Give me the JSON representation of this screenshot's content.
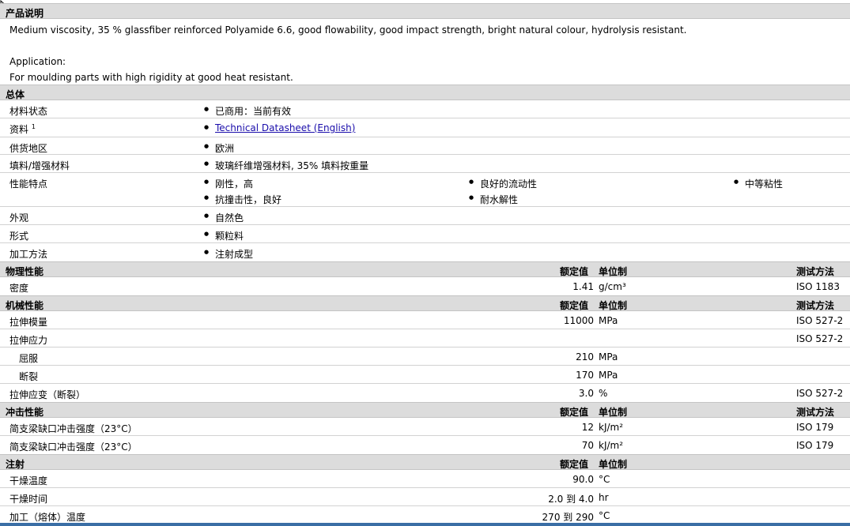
{
  "product_description": {
    "header": "产品说明",
    "line1": "Medium viscosity, 35 % glassfiber reinforced Polyamide 6.6, good flowability, good impact strength, bright natural colour, hydrolysis resistant.",
    "line2": "Application:",
    "line3": "For moulding parts with high rigidity at good heat resistant."
  },
  "general": {
    "header": "总体",
    "rows": [
      {
        "label": "材料状态",
        "value": "已商用：当前有效"
      },
      {
        "label": "资料",
        "sup": "1",
        "value": "Technical Datasheet (English)"
      },
      {
        "label": "供货地区",
        "value": "欧洲"
      },
      {
        "label": "填料/增强材料",
        "value": "玻璃纤维增强材料, 35% 填料按重量"
      },
      {
        "label": "性能特点",
        "values": [
          "刚性，高",
          "良好的流动性",
          "中等粘性",
          "抗撞击性，良好",
          "耐水解性"
        ]
      },
      {
        "label": "外观",
        "value": "自然色"
      },
      {
        "label": "形式",
        "value": "颗粒料"
      },
      {
        "label": "加工方法",
        "value": "注射成型"
      }
    ]
  },
  "headers": {
    "nominal": "额定值",
    "unit": "单位制",
    "method": "测试方法"
  },
  "physical": {
    "header": "物理性能",
    "rows": [
      {
        "label": "密度",
        "value": "1.41",
        "unit": "g/cm³",
        "method": "ISO 1183"
      }
    ]
  },
  "mechanical": {
    "header": "机械性能",
    "rows": [
      {
        "label": "拉伸模量",
        "value": "11000",
        "unit": "MPa",
        "method": "ISO 527-2"
      },
      {
        "label": "拉伸应力",
        "value": "",
        "unit": "",
        "method": "ISO 527-2"
      },
      {
        "label": "屈服",
        "value": "210",
        "unit": "MPa",
        "method": ""
      },
      {
        "label": "断裂",
        "value": "170",
        "unit": "MPa",
        "method": ""
      },
      {
        "label": "拉伸应变（断裂）",
        "value": "3.0",
        "unit": "%",
        "method": "ISO 527-2"
      }
    ]
  },
  "impact": {
    "header": "冲击性能",
    "rows": [
      {
        "label": "简支梁缺口冲击强度（23°C）",
        "value": "12",
        "unit": "kJ/m²",
        "method": "ISO 179"
      },
      {
        "label": "简支梁缺口冲击强度（23°C）",
        "value": "70",
        "unit": "kJ/m²",
        "method": "ISO 179"
      }
    ]
  },
  "injection": {
    "header": "注射",
    "rows": [
      {
        "label": "干燥温度",
        "value": "90.0",
        "unit": "°C"
      },
      {
        "label": "干燥时间",
        "value": "2.0 到  4.0",
        "unit": "hr"
      },
      {
        "label": "加工（熔体）温度",
        "value": "270 到  290",
        "unit": "°C"
      }
    ]
  }
}
